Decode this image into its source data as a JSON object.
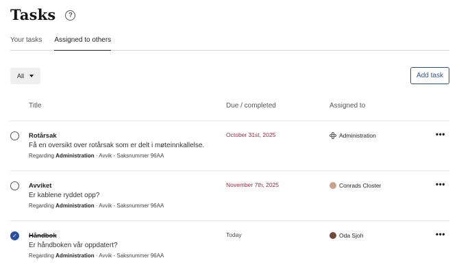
{
  "page": {
    "title": "Tasks"
  },
  "tabs": [
    {
      "label": "Your tasks",
      "active": false
    },
    {
      "label": "Assigned to others",
      "active": true
    }
  ],
  "filter": {
    "selected": "All"
  },
  "actions": {
    "add_task": "Add task"
  },
  "columns": {
    "title": "Title",
    "due": "Due / completed",
    "assigned": "Assigned to"
  },
  "tasks": [
    {
      "title": "Rotårsak",
      "description": "Få en oversikt over rotårsak som er delt i møteinnkallelse.",
      "regarding_prefix": "Regarding",
      "regarding": "Administration",
      "regarding_suffix": " · Avvik - Saksnummer 96AA",
      "due": "October 31st, 2025",
      "assignee": "Administration",
      "completed": false
    },
    {
      "title": "Avviket",
      "description": "Er kablene ryddet opp?",
      "regarding_prefix": "Regarding",
      "regarding": "Administration",
      "regarding_suffix": " · Avvik - Saksnummer 96AA",
      "due": "November 7th, 2025",
      "assignee": "Conrads Closter",
      "completed": false
    },
    {
      "title": "Håndbok",
      "description": "Er håndboken vår oppdatert?",
      "regarding_prefix": "Regarding",
      "regarding": "Administration",
      "regarding_suffix": " · Avvik - Saksnummer 96AA",
      "due": "Today",
      "assignee": "Oda Sjoh",
      "completed": true
    }
  ],
  "icons": {
    "help": "help-icon",
    "more": "more-icon",
    "check": "check-icon"
  },
  "colors": {
    "accent": "#2e4f8a",
    "due_overdue": "#a3263f"
  }
}
